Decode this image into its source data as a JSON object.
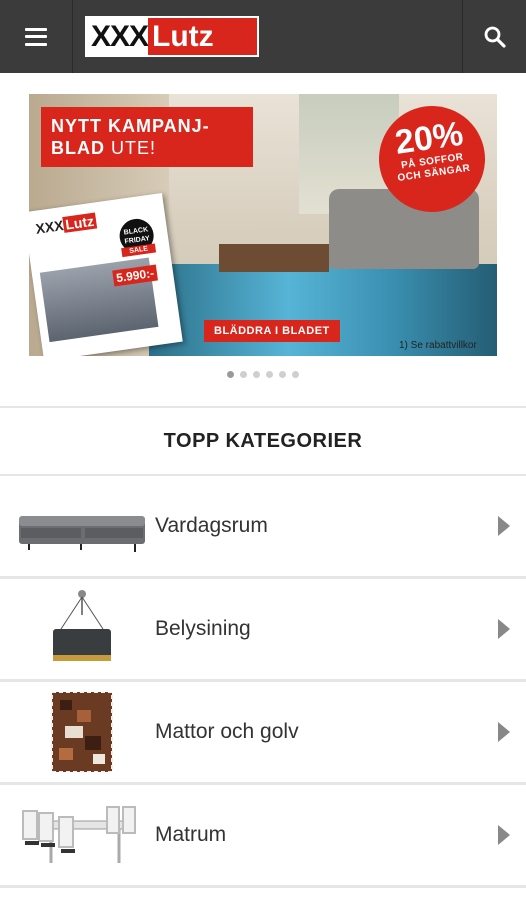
{
  "header": {
    "logo": {
      "left": "XXX",
      "right": "Lutz"
    },
    "menu_icon": "hamburger-menu-icon",
    "search_icon": "search-icon",
    "colors": {
      "bar": "#3b3b3b",
      "brand_red": "#d9261c"
    }
  },
  "banner": {
    "headline_line1": "NYTT KAMPANJ-",
    "headline_line2_bold": "BLAD",
    "headline_line2_light": " UTE!",
    "discount": "20%",
    "discount_sub1": "PÅ SOFFOR",
    "discount_sub2": "OCH SÄNGAR",
    "catalog_logo_left": "XXX",
    "catalog_logo_right": "Lutz",
    "catalog_price": "5.990:-",
    "catalog_badge_top": "BLACK FRIDAY",
    "catalog_badge_sale": "SALE",
    "cta": "BLÄDDRA I BLADET",
    "footnote": "1) Se rabattvillkor",
    "slides_total": 6,
    "active_slide": 1
  },
  "section": {
    "title": "TOPP KATEGORIER"
  },
  "categories": [
    {
      "label": "Vardagsrum",
      "icon": "sofa-thumbnail"
    },
    {
      "label": "Belysining",
      "icon": "pendant-lamp-thumbnail"
    },
    {
      "label": "Mattor och golv",
      "icon": "rug-thumbnail"
    },
    {
      "label": "Matrum",
      "icon": "dining-set-thumbnail"
    }
  ]
}
